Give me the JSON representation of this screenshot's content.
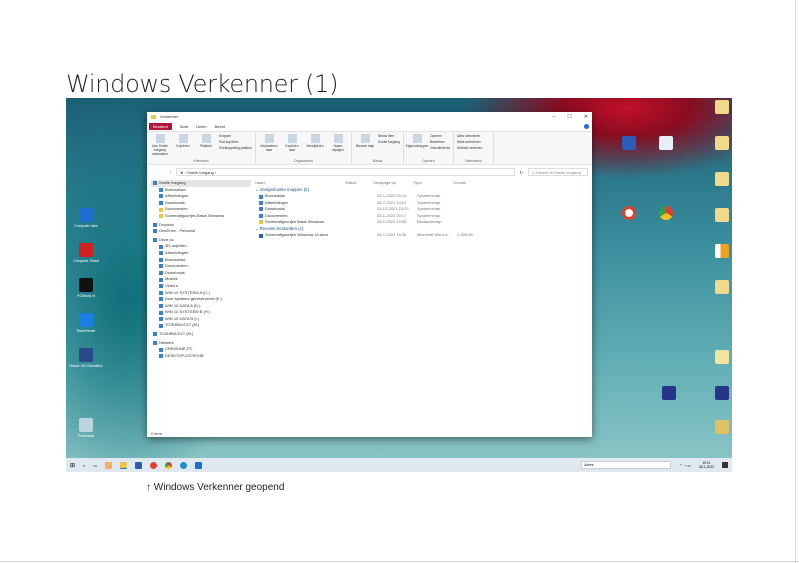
{
  "page": {
    "title": "Windows Verkenner (1)",
    "caption": "↑ Windows Verkenner geopend"
  },
  "explorer": {
    "title": "Verkenner",
    "tabs": [
      "Bestand",
      "Start",
      "Delen",
      "Beeld"
    ],
    "ribbon": {
      "groups": [
        {
          "label": "Klembord",
          "buttons": [
            "Aan Snelle toegang vastmaken",
            "Kopiëren",
            "Plakken"
          ],
          "small": [
            "Knippen",
            "Pad kopiëren",
            "Snelkoppeling plakken"
          ]
        },
        {
          "label": "Organiseren",
          "buttons": [
            "Verplaatsen naar",
            "Kopiëren naar",
            "Verwijderen",
            "Naam wijzigen"
          ],
          "small": []
        },
        {
          "label": "Nieuw",
          "buttons": [
            "Nieuwe map"
          ],
          "small": [
            "Nieuw item",
            "Snelle toegang"
          ]
        },
        {
          "label": "Openen",
          "buttons": [
            "Eigenschappen"
          ],
          "small": [
            "Openen",
            "Bewerken",
            "Geschiedenis"
          ]
        },
        {
          "label": "Selecteren",
          "buttons": [],
          "small": [
            "Alles selecteren",
            "Niets selecteren",
            "Selectie omkeren"
          ]
        }
      ]
    },
    "address": "Snelle toegang",
    "search_placeholder": "Zoeken in Snelle toegang",
    "nav": [
      "Snelle toegang",
      "Bureaublad",
      "Afbeeldingen",
      "Downloads",
      "Documenten",
      "Schemafiguurtjes Basis Windows",
      "Dropbox",
      "OneDrive - Personal",
      "Deze pc",
      "3D-objecten",
      "Afbeeldingen",
      "Bureaublad",
      "Documenten",
      "Downloads",
      "Muziek",
      "Video's",
      "WIN 10 SYSTEEM A (C:)",
      "Door systeem gereserveerd (E:)",
      "WIN 10 DATA A (D:)",
      "WIN 10 SYSTEEM B (H:)",
      "WIN 10 DATA B (I:)",
      "TOSHIBA EXT (M:)",
      "TOSHIBA EXT (M:)",
      "Netwerk",
      "CREMLINE-PC",
      "DESKTOP-KS7IICHB"
    ],
    "columns": [
      "Naam",
      "Status",
      "Gewijzigd op",
      "Type",
      "Grootte"
    ],
    "group1": "Veelgebruikte mappen (5)",
    "folders": [
      [
        "Bureaublad",
        "",
        "25-1-2022 20:14",
        "Systeemmap",
        ""
      ],
      [
        "Afbeeldingen",
        "",
        "28-7-2021 14:01",
        "Systeemmap",
        ""
      ],
      [
        "Downloads",
        "",
        "23-12-2021 15:23",
        "Systeemmap",
        ""
      ],
      [
        "Documenten",
        "",
        "25-1-2022 20:17",
        "Systeemmap",
        ""
      ],
      [
        "Schemafiguurtjes Basis Windows",
        "",
        "28-1-2022 15:50",
        "Bestandsmap",
        ""
      ]
    ],
    "group2": "Recente bestanden (1)",
    "recent": [
      [
        "Schemafiguurtjes Windows 10.docx",
        "",
        "28-1-2022 15:36",
        "Microsoft Word-d...",
        "1.398 kB"
      ]
    ],
    "status": "8 items"
  },
  "desktop": {
    "left_icons": [
      "Computer Idee",
      "Computer Totaal",
      "PCWorld.nl",
      "TeamViewer",
      "Oracle VM VirtualBox",
      "Prullenbak"
    ]
  },
  "taskbar": {
    "search": "Adres",
    "time": "19:11",
    "date": "28-1-2022"
  }
}
